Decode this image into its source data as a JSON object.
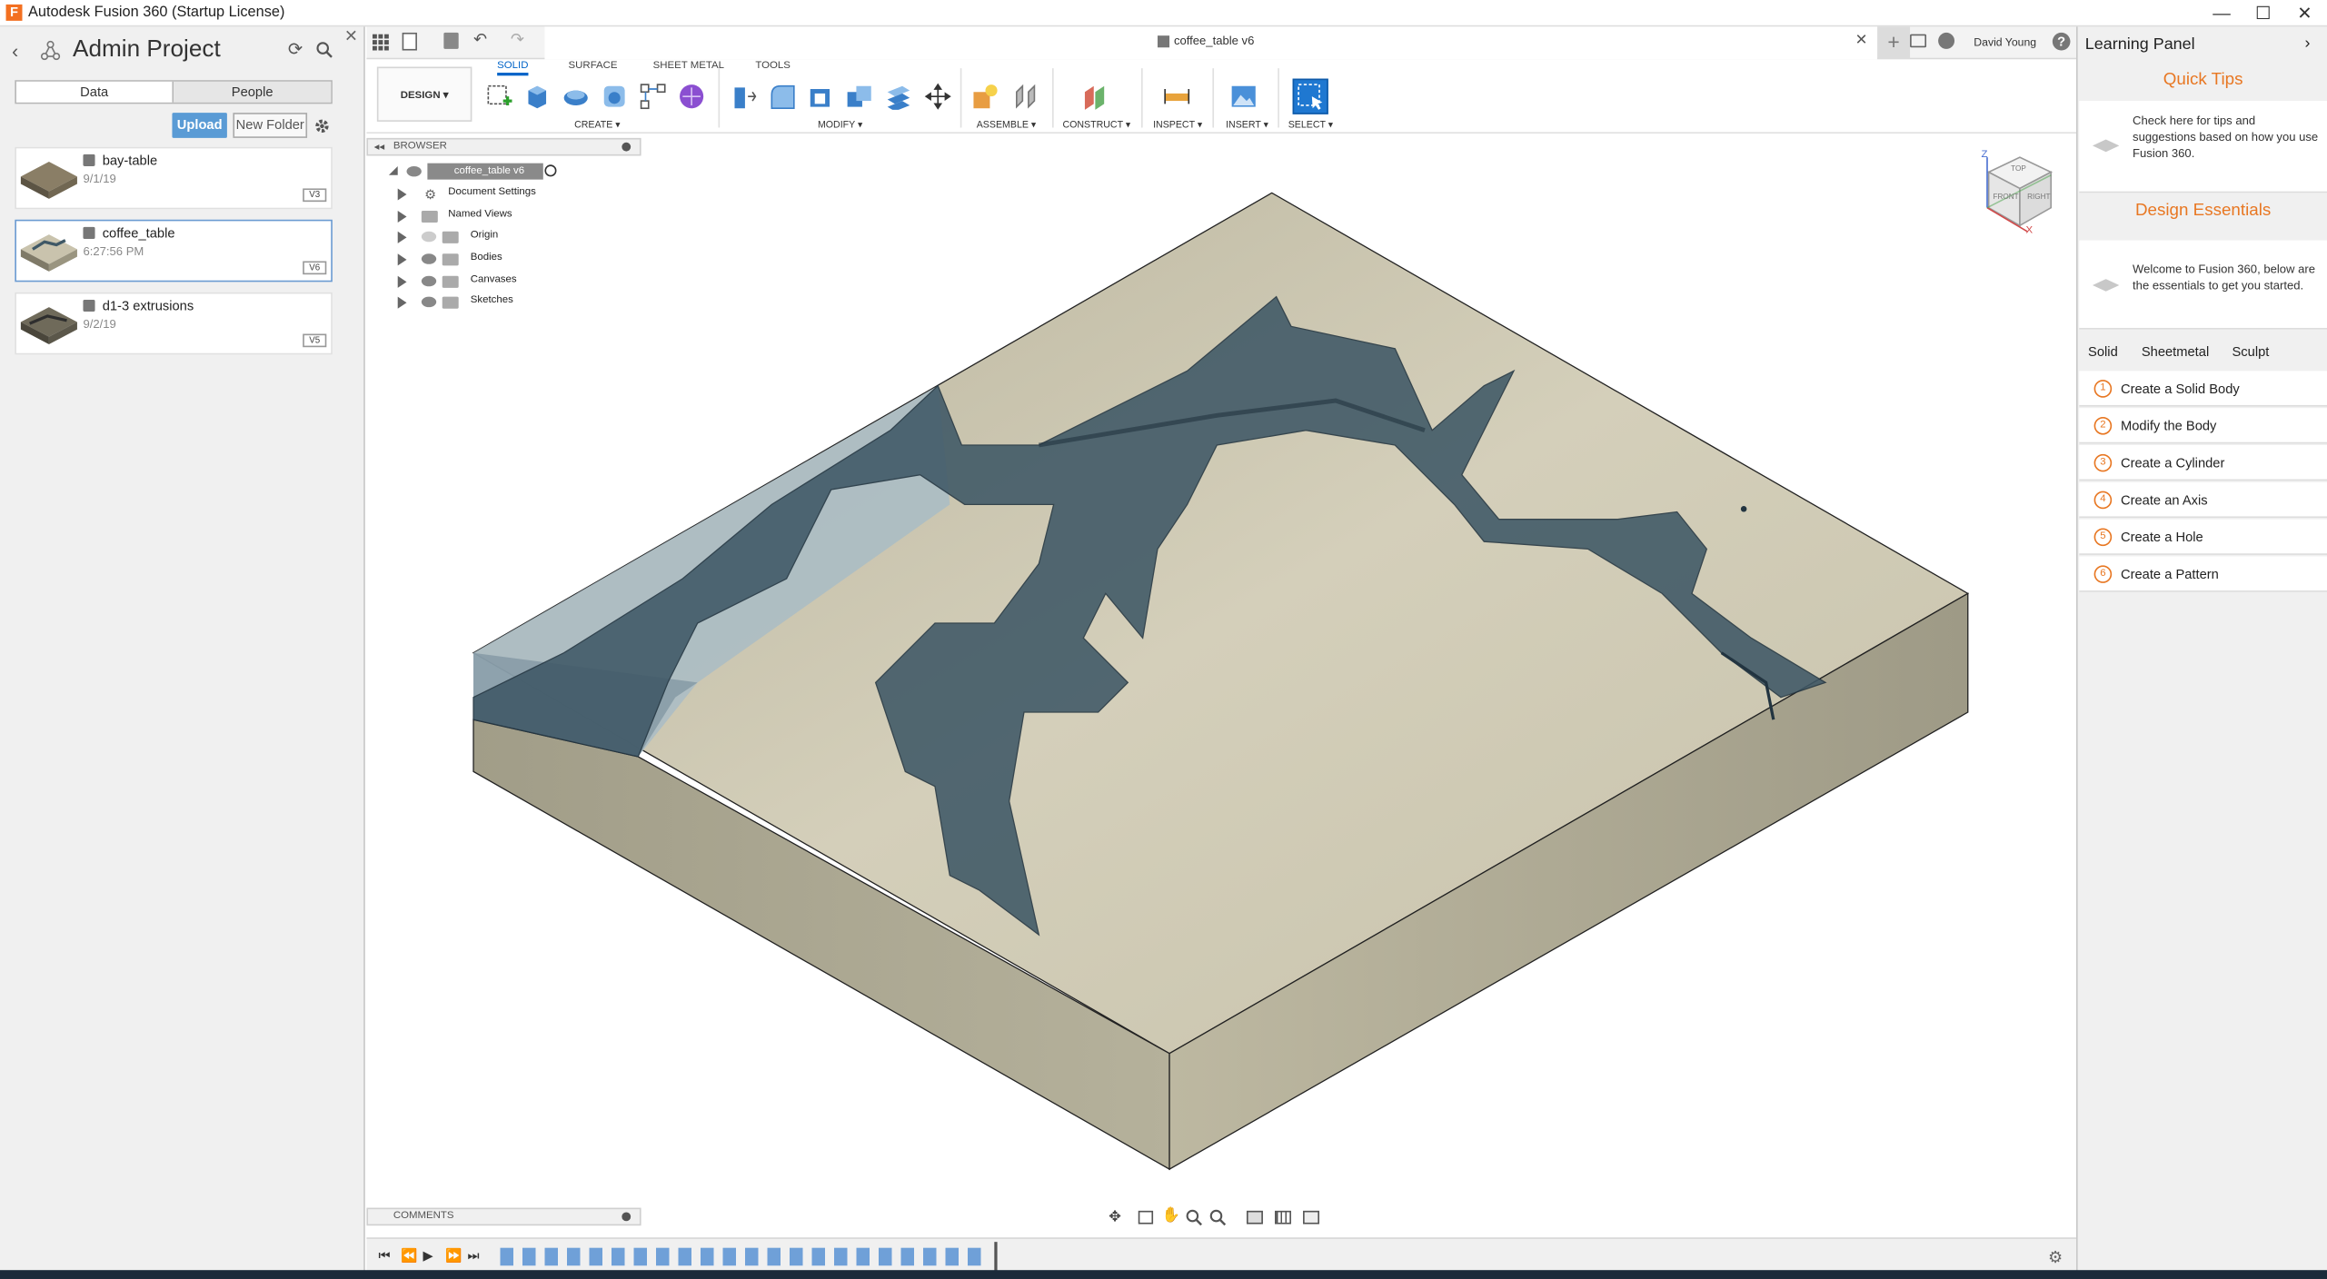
{
  "window": {
    "title": "Autodesk Fusion 360 (Startup License)",
    "minimize": "—",
    "maximize": "☐",
    "close": "✕"
  },
  "data_panel": {
    "project_title": "Admin Project",
    "tabs": [
      "Data",
      "People"
    ],
    "upload_label": "Upload",
    "new_folder_label": "New Folder",
    "files": [
      {
        "name": "bay-table",
        "date": "9/1/19",
        "version": "V3"
      },
      {
        "name": "coffee_table",
        "date": "6:27:56 PM",
        "version": "V6"
      },
      {
        "name": "d1-3 extrusions",
        "date": "9/2/19",
        "version": "V5"
      }
    ]
  },
  "header": {
    "doc_tab": "coffee_table v6",
    "user": "David Young",
    "help": "?"
  },
  "ribbon": {
    "workspace": "DESIGN ▾",
    "tabs": [
      "SOLID",
      "SURFACE",
      "SHEET METAL",
      "TOOLS"
    ],
    "groups": [
      "CREATE ▾",
      "MODIFY ▾",
      "ASSEMBLE ▾",
      "CONSTRUCT ▾",
      "INSPECT ▾",
      "INSERT ▾",
      "SELECT ▾"
    ]
  },
  "browser": {
    "title": "BROWSER",
    "root": "coffee_table v6",
    "items": [
      "Document Settings",
      "Named Views",
      "Origin",
      "Bodies",
      "Canvases",
      "Sketches"
    ]
  },
  "viewcube": {
    "top": "TOP",
    "front": "FRONT",
    "right": "RIGHT",
    "z": "Z",
    "x": "X"
  },
  "comments": {
    "title": "COMMENTS"
  },
  "learning_panel": {
    "title": "Learning Panel",
    "quick_tips_heading": "Quick Tips",
    "quick_tips_text": "Check here for tips and suggestions based on how you use Fusion 360.",
    "essentials_heading": "Design Essentials",
    "essentials_text": "Welcome to Fusion 360, below are the essentials to get you started.",
    "tabs": [
      "Solid",
      "Sheetmetal",
      "Sculpt"
    ],
    "steps": [
      {
        "num": "1",
        "label": "Create a Solid Body"
      },
      {
        "num": "2",
        "label": "Modify the Body"
      },
      {
        "num": "3",
        "label": "Create a Cylinder"
      },
      {
        "num": "4",
        "label": "Create an Axis"
      },
      {
        "num": "5",
        "label": "Create a Hole"
      },
      {
        "num": "6",
        "label": "Create a Pattern"
      }
    ]
  },
  "colors": {
    "accent": "#0064c8",
    "learning_orange": "#e87722",
    "upload_blue": "#5a9bd5",
    "water": "#3f5866",
    "stone_top": "#cfc9b3",
    "stone_side": "#a8a48f"
  }
}
